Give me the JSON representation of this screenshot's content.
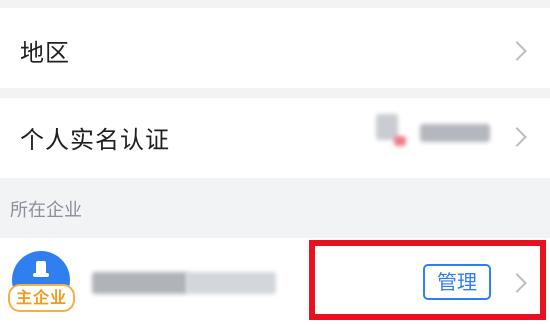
{
  "settings": {
    "region_label": "地区",
    "verification_label": "个人实名认证"
  },
  "enterprise": {
    "section_title": "所在企业",
    "primary_badge": "主企业",
    "manage_label": "管理"
  },
  "icons": {
    "chevron": "chevron-right-icon",
    "avatar": "enterprise-avatar-icon"
  },
  "colors": {
    "accent": "#2f7ff0",
    "badge": "#f29a1c",
    "highlight": "#e8111d"
  }
}
